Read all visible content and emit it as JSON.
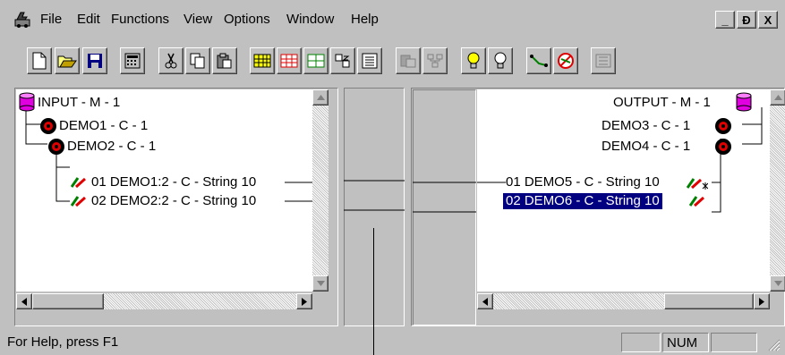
{
  "menu": {
    "items": [
      {
        "label": "File"
      },
      {
        "label": "Edit"
      },
      {
        "label": "Functions"
      },
      {
        "label": "View"
      },
      {
        "label": "Options"
      },
      {
        "label": "Window"
      },
      {
        "label": "Help"
      }
    ],
    "window_buttons": [
      "_",
      "Ɖ",
      "X"
    ]
  },
  "toolbar": {
    "buttons": [
      "new-icon",
      "open-icon",
      "save-icon",
      "calculator-icon",
      "cut-icon",
      "copy-icon",
      "paste-icon",
      "grid-icon",
      "table-icon",
      "chart-icon",
      "sort-icon",
      "list-icon",
      "link-icon",
      "network-icon",
      "light-on-icon",
      "light-off-icon",
      "connect-icon",
      "disconnect-icon",
      "export-icon"
    ]
  },
  "left_tree": {
    "root": "INPUT - M - 1",
    "children": [
      "DEMO1 - C - 1",
      "DEMO2 - C - 1"
    ],
    "fields": [
      "01 DEMO1:2 - C - String 10",
      "02 DEMO2:2 - C - String 10"
    ]
  },
  "right_tree": {
    "root": "OUTPUT - M - 1",
    "children": [
      "DEMO3 - C - 1",
      "DEMO4 - C - 1"
    ],
    "fields": [
      "01 DEMO5 - C - String 10",
      "02 DEMO6 - C - String 10"
    ],
    "selected_field": "02 DEMO6 - C - String 10"
  },
  "status": {
    "help_text": "For Help, press F1",
    "num_indicator": "NUM"
  },
  "colors": {
    "window_bg": "#c0c0c0",
    "selection_bg": "#000080",
    "cylinder": "#e000e0",
    "node_red": "#e00000"
  }
}
